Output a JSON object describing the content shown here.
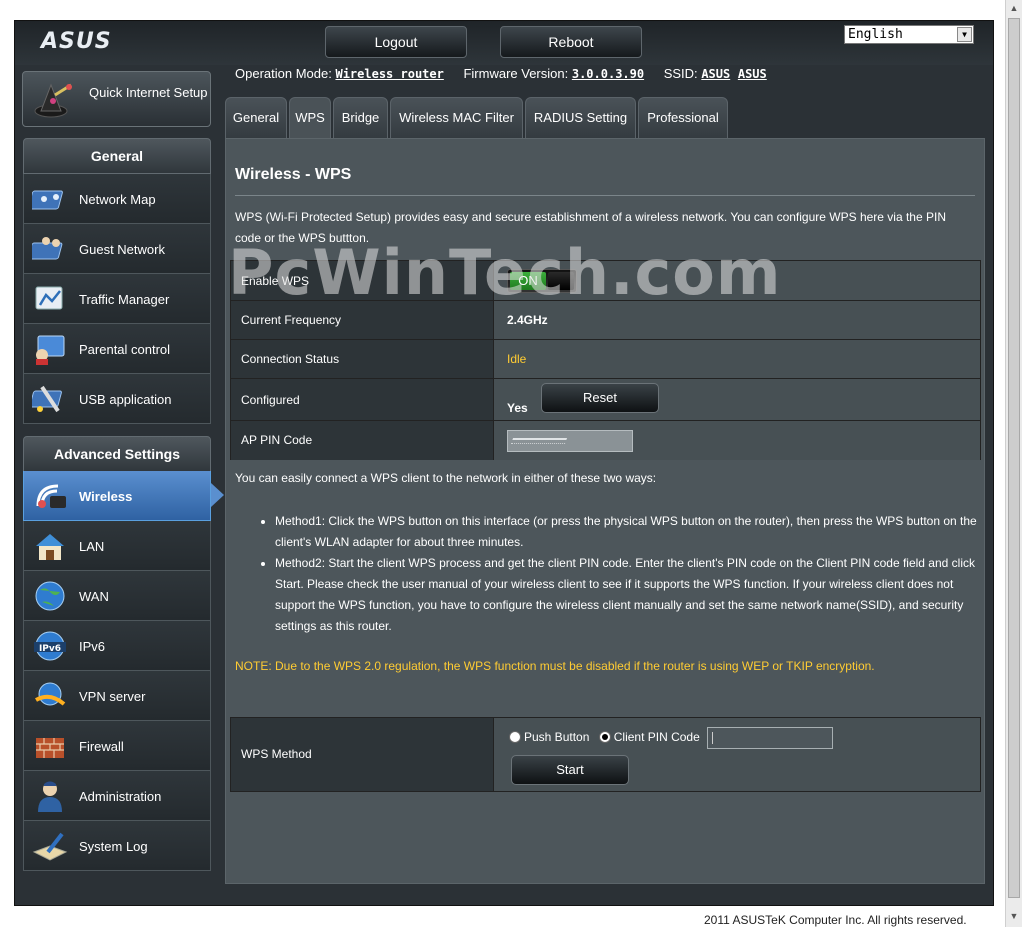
{
  "header": {
    "logo": "ASUS",
    "logout_label": "Logout",
    "reboot_label": "Reboot",
    "language": "English"
  },
  "status": {
    "op_mode_label": "Operation Mode:",
    "op_mode_value": "Wireless router",
    "firmware_label": "Firmware Version:",
    "firmware_value": "3.0.0.3.90",
    "ssid_label": "SSID:",
    "ssid_value1": "ASUS",
    "ssid_value2": "ASUS"
  },
  "sidebar": {
    "quick_setup": "Quick Internet Setup",
    "general_title": "General",
    "general_items": [
      {
        "label": "Network Map",
        "icon": "network-map-icon"
      },
      {
        "label": "Guest Network",
        "icon": "guest-network-icon"
      },
      {
        "label": "Traffic Manager",
        "icon": "traffic-manager-icon"
      },
      {
        "label": "Parental control",
        "icon": "parental-control-icon"
      },
      {
        "label": "USB application",
        "icon": "usb-application-icon"
      }
    ],
    "advanced_title": "Advanced Settings",
    "advanced_items": [
      {
        "label": "Wireless",
        "icon": "wireless-icon"
      },
      {
        "label": "LAN",
        "icon": "lan-icon"
      },
      {
        "label": "WAN",
        "icon": "wan-icon"
      },
      {
        "label": "IPv6",
        "icon": "ipv6-icon"
      },
      {
        "label": "VPN server",
        "icon": "vpn-server-icon"
      },
      {
        "label": "Firewall",
        "icon": "firewall-icon"
      },
      {
        "label": "Administration",
        "icon": "administration-icon"
      },
      {
        "label": "System Log",
        "icon": "system-log-icon"
      }
    ],
    "active_item": "Wireless"
  },
  "tabs": [
    {
      "label": "General"
    },
    {
      "label": "WPS"
    },
    {
      "label": "Bridge"
    },
    {
      "label": "Wireless MAC Filter"
    },
    {
      "label": "RADIUS Setting"
    },
    {
      "label": "Professional"
    }
  ],
  "active_tab": "WPS",
  "panel": {
    "title": "Wireless - WPS",
    "description": "WPS (Wi-Fi Protected Setup) provides easy and secure establishment of a wireless network. You can configure WPS here via the PIN code or the WPS buttton.",
    "rows": {
      "enable_wps_label": "Enable WPS",
      "enable_wps_value": "ON",
      "frequency_label": "Current Frequency",
      "frequency_value": "2.4GHz",
      "connection_label": "Connection Status",
      "connection_value": "Idle",
      "configured_label": "Configured",
      "configured_value": "Yes",
      "reset_label": "Reset",
      "ap_pin_label": "AP PIN Code"
    },
    "howto": "You can easily connect a WPS client to the network in either of these two ways:",
    "method1": "Method1: Click the WPS button on this interface (or press the physical WPS button on the router), then press the WPS button on the client's WLAN adapter for about three minutes.",
    "method2": "Method2: Start the client WPS process and get the client PIN code. Enter the client's PIN code on the Client PIN code field and click Start. Please check the user manual of your wireless client to see if it supports the WPS function. If your wireless client does not support the WPS function, you have to configure the wireless client manually and set the same network name(SSID), and security settings as this router.",
    "note": "NOTE: Due to the WPS 2.0 regulation, the WPS function must be disabled if the router is using WEP or TKIP encryption.",
    "wps_method_label": "WPS Method",
    "push_button_label": "Push Button",
    "client_pin_label": "Client PIN Code",
    "start_label": "Start"
  },
  "watermark": "PcWinTech.com",
  "footer": "2011 ASUSTeK Computer Inc. All rights reserved.",
  "colors": {
    "accent_blue": "#4a86c8",
    "note_yellow": "#ffcc33",
    "on_green": "#2e9b2e"
  }
}
